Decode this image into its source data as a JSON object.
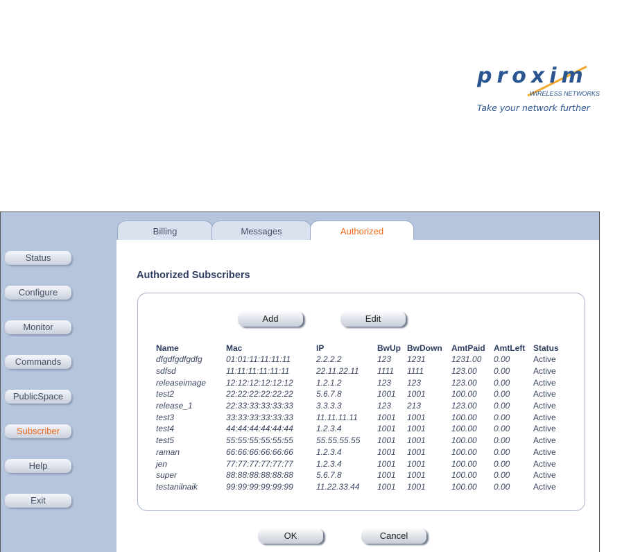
{
  "logo": {
    "word": "proxim",
    "subtitle": "WIRELESS NETWORKS",
    "tagline": "Take your network further"
  },
  "tabs": [
    {
      "label": "Billing"
    },
    {
      "label": "Messages"
    },
    {
      "label": "Authorized"
    }
  ],
  "sidebar": [
    {
      "label": "Status"
    },
    {
      "label": "Configure"
    },
    {
      "label": "Monitor"
    },
    {
      "label": "Commands"
    },
    {
      "label": "PublicSpace"
    },
    {
      "label": "Subscriber"
    },
    {
      "label": "Help"
    },
    {
      "label": "Exit"
    }
  ],
  "page_title": "Authorized Subscribers",
  "buttons": {
    "add": "Add",
    "edit": "Edit",
    "ok": "OK",
    "cancel": "Cancel"
  },
  "columns": [
    "Name",
    "Mac",
    "IP",
    "BwUp",
    "BwDown",
    "AmtPaid",
    "AmtLeft",
    "Status"
  ],
  "rows": [
    [
      "dfgdfgdfgdfg",
      "01:01:11:11:11:11",
      "2.2.2.2",
      "123",
      "1231",
      "1231.00",
      "0.00",
      "Active"
    ],
    [
      "sdfsd",
      "11:11:11:11:11:11",
      "22.11.22.11",
      "1111",
      "1111",
      "123.00",
      "0.00",
      "Active"
    ],
    [
      "releaseimage",
      "12:12:12:12:12:12",
      "1.2.1.2",
      "123",
      "123",
      "123.00",
      "0.00",
      "Active"
    ],
    [
      "test2",
      "22:22:22:22:22:22",
      "5.6.7.8",
      "1001",
      "1001",
      "100.00",
      "0.00",
      "Active"
    ],
    [
      "release_1",
      "22:33:33:33:33:33",
      "3.3.3.3",
      "123",
      "213",
      "123.00",
      "0.00",
      "Active"
    ],
    [
      "test3",
      "33:33:33:33:33:33",
      "11.11.11.11",
      "1001",
      "1001",
      "100.00",
      "0.00",
      "Active"
    ],
    [
      "test4",
      "44:44:44:44:44:44",
      "1.2.3.4",
      "1001",
      "1001",
      "100.00",
      "0.00",
      "Active"
    ],
    [
      "test5",
      "55:55:55:55:55:55",
      "55.55.55.55",
      "1001",
      "1001",
      "100.00",
      "0.00",
      "Active"
    ],
    [
      "raman",
      "66:66:66:66:66:66",
      "1.2.3.4",
      "1001",
      "1001",
      "100.00",
      "0.00",
      "Active"
    ],
    [
      "jen",
      "77:77:77:77:77:77",
      "1.2.3.4",
      "1001",
      "1001",
      "100.00",
      "0.00",
      "Active"
    ],
    [
      "super",
      "88:88:88:88:88:88",
      "5.6.7.8",
      "1001",
      "1001",
      "100.00",
      "0.00",
      "Active"
    ],
    [
      "testanilnaik",
      "99:99:99:99:99:99",
      "11.22.33.44",
      "1001",
      "1001",
      "100.00",
      "0.00",
      "Active"
    ]
  ]
}
